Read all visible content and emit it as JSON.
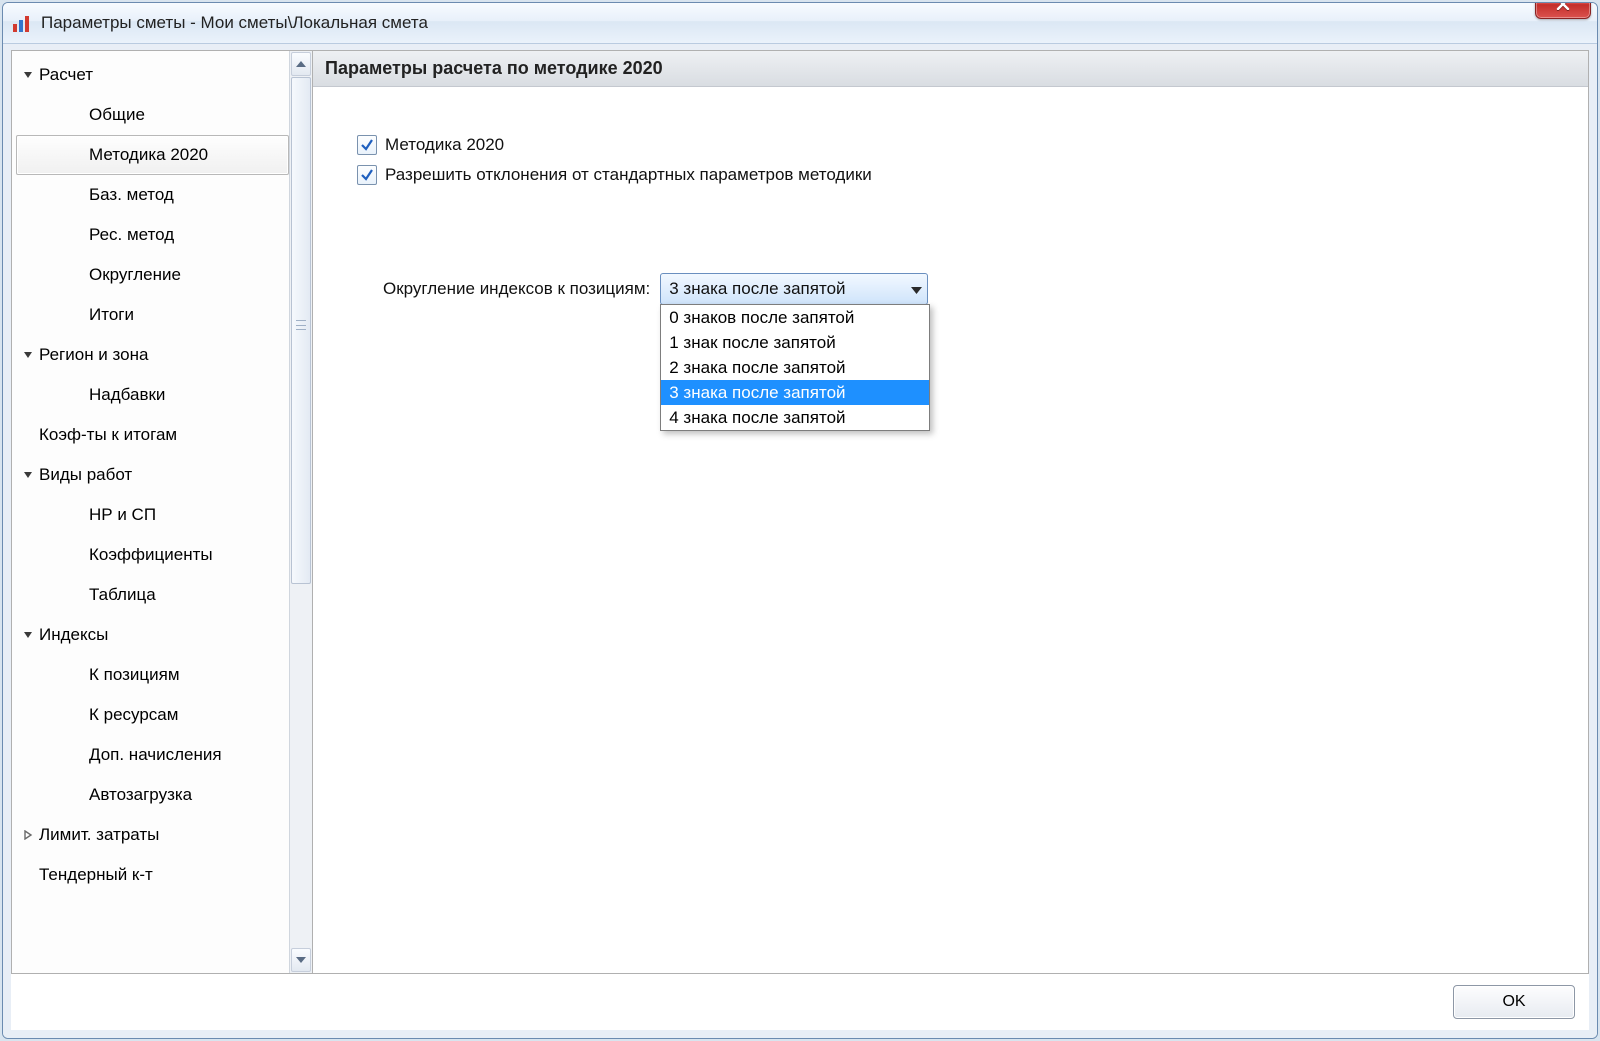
{
  "window": {
    "title": "Параметры сметы - Мои сметы\\Локальная смета"
  },
  "nav": {
    "items": [
      {
        "label": "Расчет",
        "level": 1,
        "caret": "down",
        "selected": false
      },
      {
        "label": "Общие",
        "level": 2,
        "caret": "",
        "selected": false
      },
      {
        "label": "Методика 2020",
        "level": 2,
        "caret": "",
        "selected": true
      },
      {
        "label": "Баз. метод",
        "level": 2,
        "caret": "",
        "selected": false
      },
      {
        "label": "Рес. метод",
        "level": 2,
        "caret": "",
        "selected": false
      },
      {
        "label": "Округление",
        "level": 2,
        "caret": "",
        "selected": false
      },
      {
        "label": "Итоги",
        "level": 2,
        "caret": "",
        "selected": false
      },
      {
        "label": "Регион и зона",
        "level": 1,
        "caret": "down",
        "selected": false
      },
      {
        "label": "Надбавки",
        "level": 2,
        "caret": "",
        "selected": false
      },
      {
        "label": "Коэф-ты к итогам",
        "level": 1,
        "caret": "",
        "selected": false
      },
      {
        "label": "Виды работ",
        "level": 1,
        "caret": "down",
        "selected": false
      },
      {
        "label": "НР и СП",
        "level": 2,
        "caret": "",
        "selected": false
      },
      {
        "label": "Коэффициенты",
        "level": 2,
        "caret": "",
        "selected": false
      },
      {
        "label": "Таблица",
        "level": 2,
        "caret": "",
        "selected": false
      },
      {
        "label": "Индексы",
        "level": 1,
        "caret": "down",
        "selected": false
      },
      {
        "label": "К позициям",
        "level": 2,
        "caret": "",
        "selected": false
      },
      {
        "label": "К ресурсам",
        "level": 2,
        "caret": "",
        "selected": false
      },
      {
        "label": "Доп. начисления",
        "level": 2,
        "caret": "",
        "selected": false
      },
      {
        "label": "Автозагрузка",
        "level": 2,
        "caret": "",
        "selected": false
      },
      {
        "label": "Лимит. затраты",
        "level": 1,
        "caret": "right",
        "selected": false
      },
      {
        "label": "Тендерный к-т",
        "level": 1,
        "caret": "",
        "selected": false
      }
    ]
  },
  "panel": {
    "header": "Параметры расчета по методике 2020",
    "chk1_label": "Методика 2020",
    "chk1_checked": true,
    "chk2_label": "Разрешить отклонения от стандартных параметров методики",
    "chk2_checked": true,
    "field_label": "Округление индексов к позициям:",
    "combo_selected": "3 знака после запятой",
    "combo_options": [
      {
        "text": "0 знаков после запятой",
        "highlight": false
      },
      {
        "text": "1 знак после запятой",
        "highlight": false
      },
      {
        "text": "2 знака после запятой",
        "highlight": false
      },
      {
        "text": "3 знака после запятой",
        "highlight": true
      },
      {
        "text": "4 знака после запятой",
        "highlight": false
      }
    ]
  },
  "footer": {
    "ok_label": "OK"
  }
}
